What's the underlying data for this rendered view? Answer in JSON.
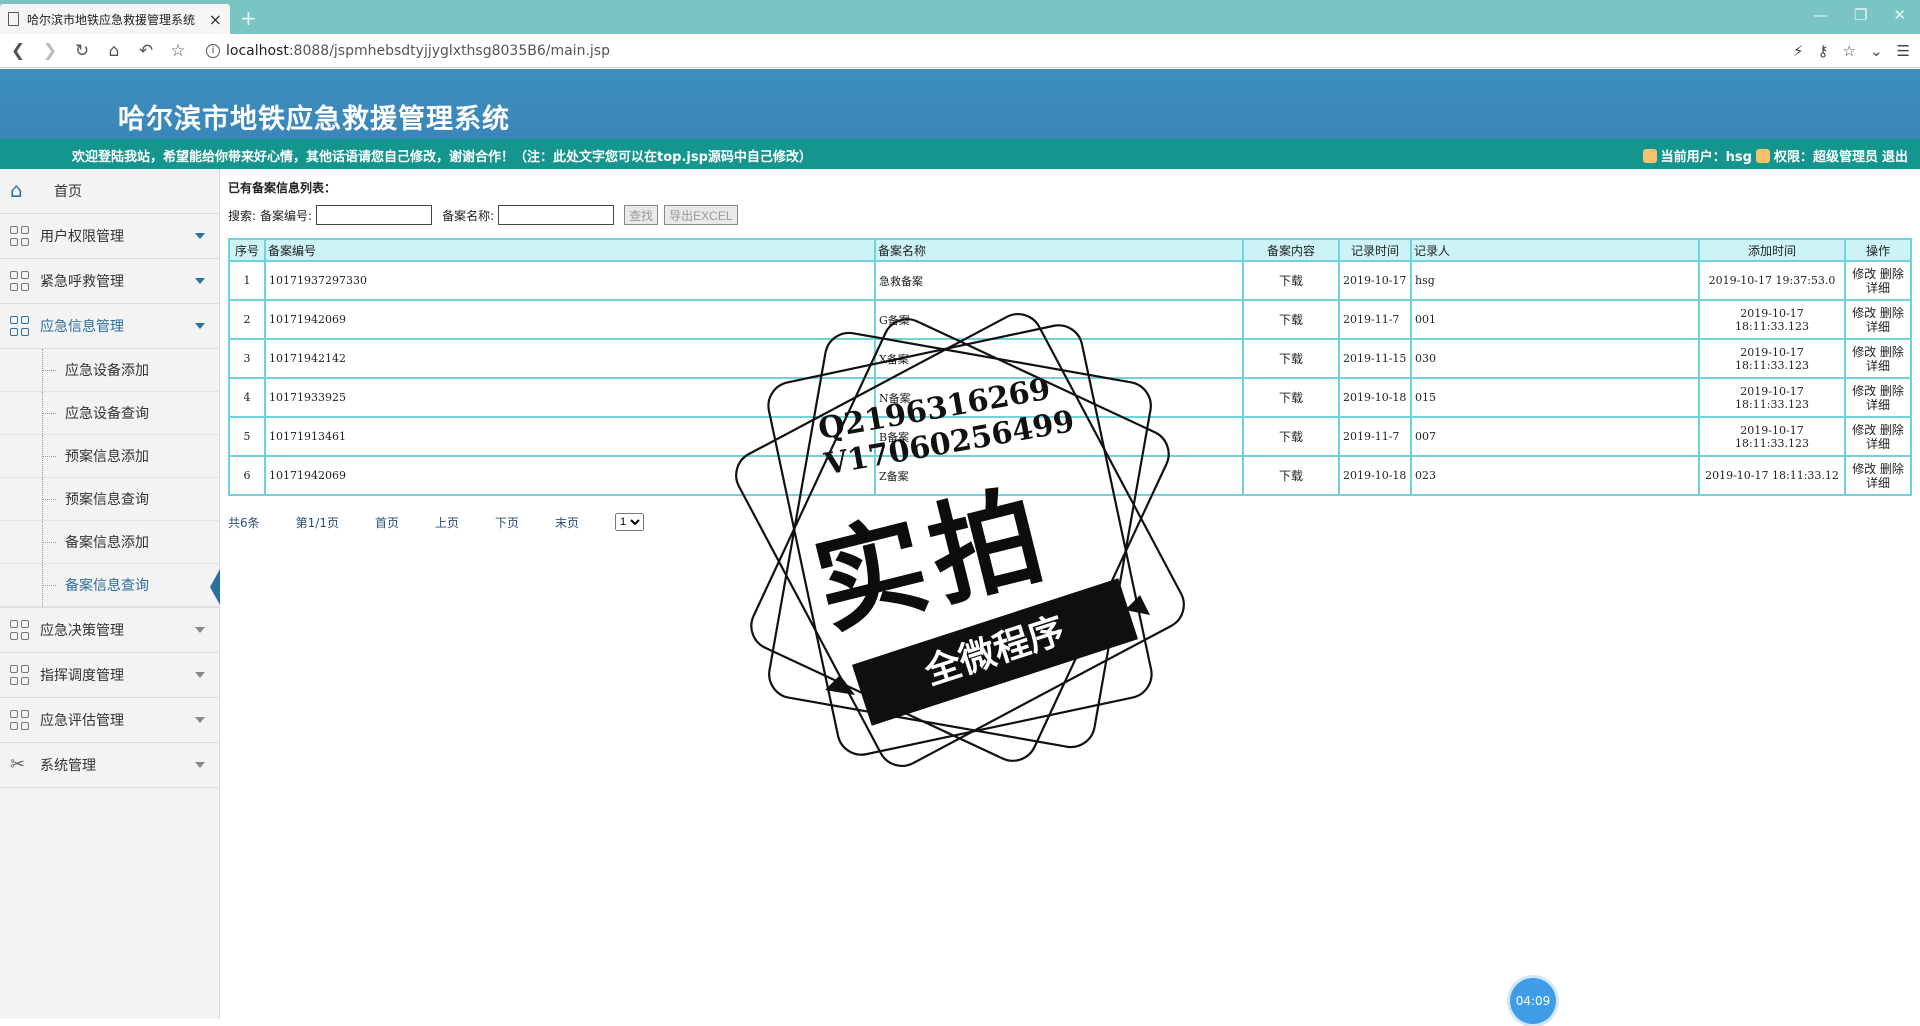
{
  "browser": {
    "tab_title": "哈尔滨市地铁应急救援管理系统",
    "url_host": "localhost",
    "url_path": ":8088/jspmhebsdtyjjyglxthsg8035B6/main.jsp"
  },
  "header": {
    "title": "哈尔滨市地铁应急救援管理系统",
    "welcome": "欢迎登陆我站，希望能给你带来好心情，其他话语请您自己修改，谢谢合作！（注：此处文字您可以在top.jsp源码中自己修改）",
    "user_label": "当前用户：hsg",
    "role_label": "权限：超级管理员",
    "logout": "退出"
  },
  "sidebar": {
    "home": "首页",
    "items": [
      {
        "label": "用户权限管理"
      },
      {
        "label": "紧急呼救管理"
      },
      {
        "label": "应急信息管理"
      },
      {
        "label": "应急决策管理"
      },
      {
        "label": "指挥调度管理"
      },
      {
        "label": "应急评估管理"
      },
      {
        "label": "系统管理"
      }
    ],
    "submenu": [
      "应急设备添加",
      "应急设备查询",
      "预案信息添加",
      "预案信息查询",
      "备案信息添加",
      "备案信息查询"
    ]
  },
  "main": {
    "list_title": "已有备案信息列表：",
    "search_label": "搜索:",
    "field1_label": "备案编号:",
    "field2_label": "备案名称:",
    "search_button": "查找",
    "export_button": "导出EXCEL",
    "columns": [
      "序号",
      "备案编号",
      "备案名称",
      "备案内容",
      "记录时间",
      "记录人",
      "添加时间",
      "操作"
    ],
    "rows": [
      {
        "no": "1",
        "code": "10171937297330",
        "name": "急救备案",
        "content": "下载",
        "date": "2019-10-17",
        "person": "hsg",
        "added": "2019-10-17 19:37:53.0"
      },
      {
        "no": "2",
        "code": "10171942069",
        "name": "G备案",
        "content": "下载",
        "date": "2019-11-7",
        "person": "001",
        "added": "2019-10-17 18:11:33.123"
      },
      {
        "no": "3",
        "code": "10171942142",
        "name": "X备案",
        "content": "下载",
        "date": "2019-11-15",
        "person": "030",
        "added": "2019-10-17 18:11:33.123"
      },
      {
        "no": "4",
        "code": "10171933925",
        "name": "N备案",
        "content": "下载",
        "date": "2019-10-18",
        "person": "015",
        "added": "2019-10-17 18:11:33.123"
      },
      {
        "no": "5",
        "code": "10171913461",
        "name": "B备案",
        "content": "下载",
        "date": "2019-11-7",
        "person": "007",
        "added": "2019-10-17 18:11:33.123"
      },
      {
        "no": "6",
        "code": "10171942069",
        "name": "Z备案",
        "content": "下载",
        "date": "2019-10-18",
        "person": "023",
        "added": "2019-10-17 18:11:33.12"
      }
    ],
    "op_edit": "修改",
    "op_delete": "删除",
    "op_detail": "详细",
    "pager": {
      "total": "共6条",
      "page": "第1/1页",
      "first": "首页",
      "prev": "上页",
      "next": "下页",
      "last": "末页",
      "selected": "1"
    }
  },
  "watermark": {
    "qq": "Q2196316269",
    "v": "V17060256499",
    "big": "实拍",
    "ribbon": "全微程序"
  },
  "timer": "04:09"
}
